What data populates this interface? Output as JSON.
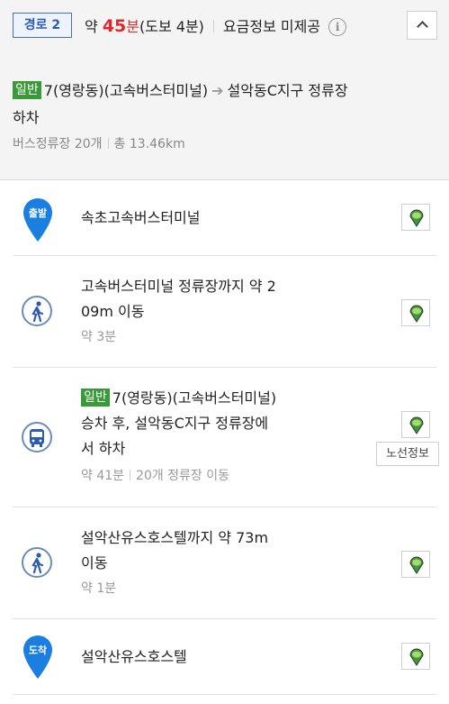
{
  "route": {
    "badge": "경로 2",
    "prefix": "약 ",
    "time_value": "45",
    "time_unit": "분",
    "walk": "(도보 4분)",
    "fare": "요금정보 미제공",
    "info_icon": "i"
  },
  "bus_summary": {
    "tag": "일반",
    "line": "7(영랑동)(고속버스터미널)",
    "arrow": "➔",
    "dest": "설악동C지구 정류장",
    "action": "하차",
    "stops": "버스정류장 20개",
    "distance": "총 13.46km"
  },
  "steps": [
    {
      "type": "start",
      "badge": "출발",
      "title": "속초고속버스터미널"
    },
    {
      "type": "walk",
      "title_line1": "고속버스터미널 정류장까지 약 2",
      "title_line2": "09m 이동",
      "sub": "약 3분"
    },
    {
      "type": "bus",
      "tag": "일반",
      "title_line1": "7(영랑동)(고속버스터미널)",
      "title_line2": "승차 후, 설악동C지구 정류장에",
      "title_line3": "서 하차",
      "sub_time": "약 41분",
      "sub_stops": "20개 정류장 이동",
      "route_info": "노선정보"
    },
    {
      "type": "walk",
      "title_line1": "설악산유스호스텔까지 약 73m",
      "title_line2": "이동",
      "sub": "약 1분"
    },
    {
      "type": "end",
      "badge": "도착",
      "title": "설악산유스호스텔"
    }
  ],
  "colors": {
    "accent_red": "#e0282b",
    "tag_green": "#3a9a3a",
    "pin_blue": "#1a7fe0",
    "badge_blue": "#2d5bb0"
  },
  "icons": [
    "info-icon",
    "chevron-up-icon",
    "location-pin-icon",
    "walk-icon",
    "bus-icon",
    "map-marker-icon"
  ]
}
